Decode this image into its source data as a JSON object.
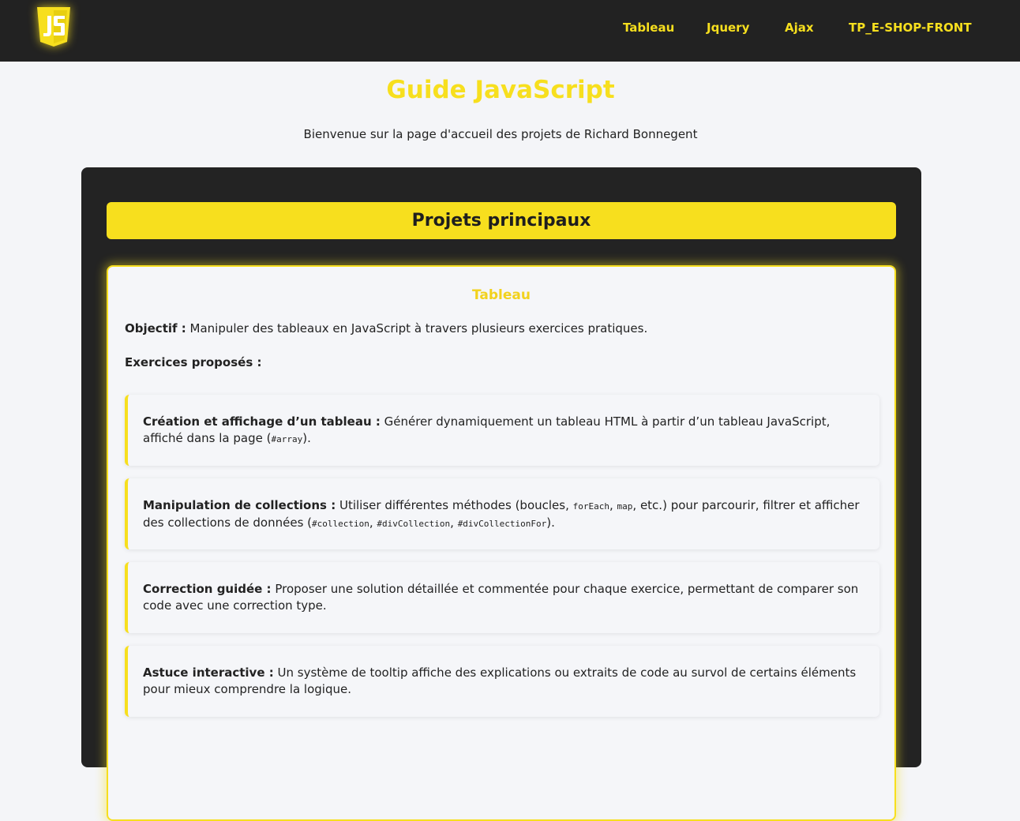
{
  "header": {
    "logo_icon": "javascript-logo-icon",
    "nav": [
      {
        "label": "Tableau"
      },
      {
        "label": "Jquery"
      },
      {
        "label": "Ajax"
      },
      {
        "label": "TP_E-SHOP-FRONT"
      }
    ]
  },
  "page": {
    "title": "Guide JavaScript",
    "subtitle": "Bienvenue sur la page d'accueil des projets de Richard Bonnegent"
  },
  "section": {
    "title": "Projets principaux"
  },
  "project": {
    "title": "Tableau",
    "objective_label": "Objectif :",
    "objective_text": " Manipuler des tableaux en JavaScript à travers plusieurs exercices pratiques.",
    "exercises_heading": "Exercices proposés :",
    "exercises": [
      {
        "label": "Création et affichage d’un tableau :",
        "text1": " Générer dynamiquement un tableau HTML à partir d’un tableau JavaScript, affiché dans la page (",
        "code1": "#array",
        "text2": ")."
      },
      {
        "label": "Manipulation de collections :",
        "text1": " Utiliser différentes méthodes (boucles, ",
        "code1": "forEach",
        "sep1": ", ",
        "code2": "map",
        "text2": ", etc.) pour parcourir, filtrer et afficher des collections de données (",
        "code3": "#collection",
        "sep2": ", ",
        "code4": "#divCollection",
        "sep3": ", ",
        "code5": "#divCollectionFor",
        "text3": ")."
      },
      {
        "label": "Correction guidée :",
        "text1": " Proposer une solution détaillée et commentée pour chaque exercice, permettant de comparer son code avec une correction type."
      },
      {
        "label": "Astuce interactive :",
        "text1": " Un système de tooltip affiche des explications ou extraits de code au survol de certains éléments pour mieux comprendre la logique."
      }
    ]
  },
  "colors": {
    "accent": "#f7df1e",
    "header_bg": "#222222",
    "panel_bg": "#232323",
    "page_bg": "#f4f5f8"
  }
}
